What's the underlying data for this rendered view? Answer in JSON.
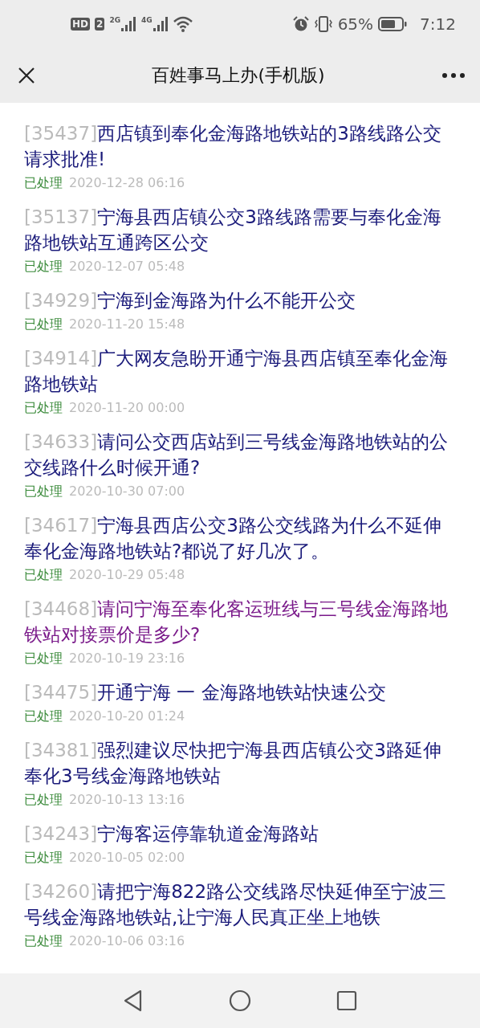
{
  "status_bar": {
    "hd_badge": "HD",
    "sim_badge": "2",
    "networks": [
      {
        "label": "2G"
      },
      {
        "label": "4G"
      }
    ],
    "battery_percent": "65%",
    "time": "7:12"
  },
  "header": {
    "title": "百姓事马上办(手机版)"
  },
  "items": [
    {
      "id": "[35437]",
      "title": "西店镇到奉化金海路地铁站的3路线路公交请求批准!",
      "visited": false,
      "status": "已处理",
      "date": "2020-12-28 06:16"
    },
    {
      "id": "[35137]",
      "title": "宁海县西店镇公交3路线路需要与奉化金海路地铁站互通跨区公交",
      "visited": false,
      "status": "已处理",
      "date": "2020-12-07 05:48"
    },
    {
      "id": "[34929]",
      "title": "宁海到金海路为什么不能开公交",
      "visited": false,
      "status": "已处理",
      "date": "2020-11-20 15:48"
    },
    {
      "id": "[34914]",
      "title": "广大网友急盼开通宁海县西店镇至奉化金海路地铁站",
      "visited": false,
      "status": "已处理",
      "date": "2020-11-20 00:00"
    },
    {
      "id": "[34633]",
      "title": "请问公交西店站到三号线金海路地铁站的公交线路什么时候开通?",
      "visited": false,
      "status": "已处理",
      "date": "2020-10-30 07:00"
    },
    {
      "id": "[34617]",
      "title": "宁海县西店公交3路公交线路为什么不延伸奉化金海路地铁站?都说了好几次了。",
      "visited": false,
      "status": "已处理",
      "date": "2020-10-29 05:48"
    },
    {
      "id": "[34468]",
      "title": "请问宁海至奉化客运班线与三号线金海路地铁站对接票价是多少?",
      "visited": true,
      "status": "已处理",
      "date": "2020-10-19 23:16"
    },
    {
      "id": "[34475]",
      "title": "开通宁海 一 金海路地铁站快速公交",
      "visited": false,
      "status": "已处理",
      "date": "2020-10-20 01:24"
    },
    {
      "id": "[34381]",
      "title": "强烈建议尽快把宁海县西店镇公交3路延伸奉化3号线金海路地铁站",
      "visited": false,
      "status": "已处理",
      "date": "2020-10-13 13:16"
    },
    {
      "id": "[34243]",
      "title": "宁海客运停靠轨道金海路站",
      "visited": false,
      "status": "已处理",
      "date": "2020-10-05 02:00"
    },
    {
      "id": "[34260]",
      "title": "请把宁海822路公交线路尽快延伸至宁波三号线金海路地铁站,让宁海人民真正坐上地铁",
      "visited": false,
      "status": "已处理",
      "date": "2020-10-06 03:16"
    }
  ]
}
